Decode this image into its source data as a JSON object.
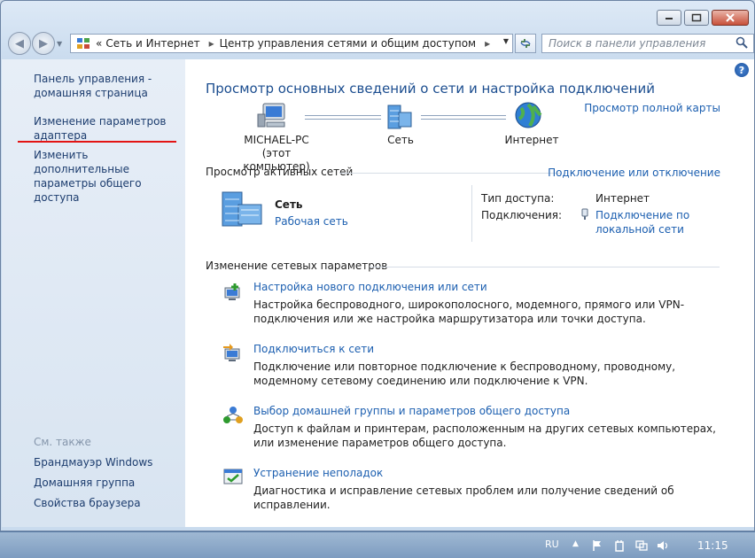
{
  "window": {
    "breadcrumb": [
      "Сеть и Интернет",
      "Центр управления сетями и общим доступом"
    ],
    "breadcrumb_prefix": "«",
    "search_placeholder": "Поиск в панели управления"
  },
  "sidebar": {
    "home": "Панель управления - домашняя страница",
    "adapter": "Изменение параметров адаптера",
    "sharing": "Изменить дополнительные параметры общего доступа",
    "see_also": "См. также",
    "links": [
      "Брандмауэр Windows",
      "Домашняя группа",
      "Свойства браузера"
    ]
  },
  "main": {
    "title": "Просмотр основных сведений о сети и настройка подключений",
    "full_map": "Просмотр полной карты",
    "nodes": [
      {
        "name": "MICHAEL-PC",
        "sub": "(этот компьютер)"
      },
      {
        "name": "Сеть"
      },
      {
        "name": "Интернет"
      }
    ],
    "active_header": "Просмотр активных сетей",
    "connect_disconnect": "Подключение или отключение",
    "network_name": "Сеть",
    "network_type": "Рабочая сеть",
    "access_type_label": "Тип доступа:",
    "access_type_value": "Интернет",
    "connections_label": "Подключения:",
    "connections_value": "Подключение по локальной сети",
    "change_header": "Изменение сетевых параметров",
    "tasks": [
      {
        "title": "Настройка нового подключения или сети",
        "desc": "Настройка беспроводного, широкополосного, модемного, прямого или VPN-подключения или же настройка маршрутизатора или точки доступа."
      },
      {
        "title": "Подключиться к сети",
        "desc": "Подключение или повторное подключение к беспроводному, проводному, модемному сетевому соединению или подключение к VPN."
      },
      {
        "title": "Выбор домашней группы и параметров общего доступа",
        "desc": "Доступ к файлам и принтерам, расположенным на других сетевых компьютерах, или изменение параметров общего доступа."
      },
      {
        "title": "Устранение неполадок",
        "desc": "Диагностика и исправление сетевых проблем или получение сведений об исправлении."
      }
    ]
  },
  "taskbar": {
    "lang": "RU",
    "time": "11:15"
  },
  "colors": {
    "link": "#1c5fb0",
    "title": "#1b4d8f",
    "highlight": "#e31414"
  }
}
